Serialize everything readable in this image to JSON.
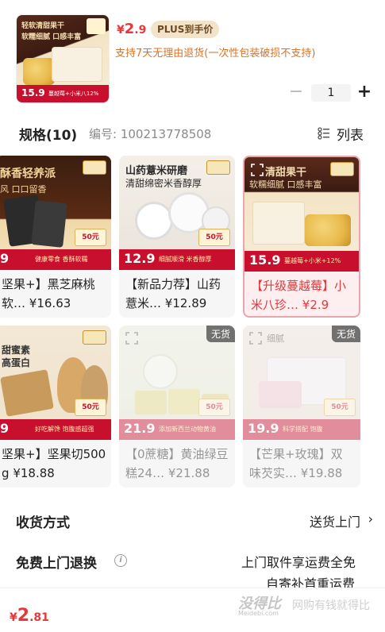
{
  "header": {
    "thumbnail": {
      "line1": "轻软清甜果干",
      "line2": "软糯细腻 口感丰富",
      "price": "15.9",
      "tag": "蔓越莓+小米八12%"
    },
    "price": {
      "currency": "¥",
      "int": "2",
      "dec": ".9"
    },
    "plus_badge": "PLUS到手价",
    "support_text": "支持7天无理由退货(一次性包装破损不支持)",
    "quantity": "1",
    "minus_label": "−",
    "plus_label": "+"
  },
  "spec": {
    "title": "规格(10)",
    "code": "编号: 100213778508",
    "list_label": "列表"
  },
  "products": [
    {
      "name": "坚果+】黑芝麻桃软…",
      "price": "¥16.63",
      "img_price": "9",
      "img_line1": "酥香轻养派",
      "img_line2": "风 口口留香",
      "img_tag": "健康零食 香酥软糯",
      "state": "normal"
    },
    {
      "name": "【新品力荐】山药薏米…",
      "price": "¥12.89",
      "img_price": "12.9",
      "img_line1": "山药薏米研磨",
      "img_line2": "清甜绵密米香醇厚",
      "img_tag": "细腻顺滑 米香醇厚",
      "state": "normal"
    },
    {
      "name": "【升级蔓越莓】小米八珍…",
      "price": "¥2.9",
      "img_price": "15.9",
      "img_line1": "清甜果干",
      "img_line2": "软糯细腻 口感丰富",
      "img_tag": "蔓越莓+小米+12%",
      "state": "selected"
    },
    {
      "name": "坚果+】坚果切500g",
      "price": "¥18.88",
      "img_price": "9",
      "img_line1": "甜蜜素",
      "img_line2": "高蛋白",
      "img_tag": "好吃解馋 饱腹感超强",
      "state": "normal"
    },
    {
      "name": "【0蔗糖】黄油绿豆糕24…",
      "price": "¥21.88",
      "img_price": "21.9",
      "img_line1": "",
      "img_line2": "",
      "img_tag": "添加新西兰动物黄油",
      "state": "out_of_stock"
    },
    {
      "name": "【芒果+玫瑰】双味芡实…",
      "price": "¥19.88",
      "img_price": "19.9",
      "img_line1": "细腻",
      "img_line2": "",
      "img_tag": "科学搭配 饱腹",
      "state": "out_of_stock"
    }
  ],
  "out_of_stock_label": "无货",
  "coupon_label": "50元",
  "delivery": {
    "label": "收货方式",
    "value": "送货上门",
    "chevron": "›"
  },
  "free_return": {
    "label": "免费上门退换",
    "info_icon": "i",
    "value1": "上门取件享运费全免",
    "value2": "自寄补首重运费"
  },
  "footer": {
    "currency": "¥",
    "int": "2",
    "dec": ".81"
  },
  "watermark": {
    "logo": "没得比",
    "sub": "Meidebi.com",
    "slogan": "网购有钱就得比"
  },
  "colors": {
    "accent": "#e4393c",
    "orange": "#d7742a",
    "plus_bg": "#f3e3c8",
    "card_bar": "#c8102e"
  }
}
